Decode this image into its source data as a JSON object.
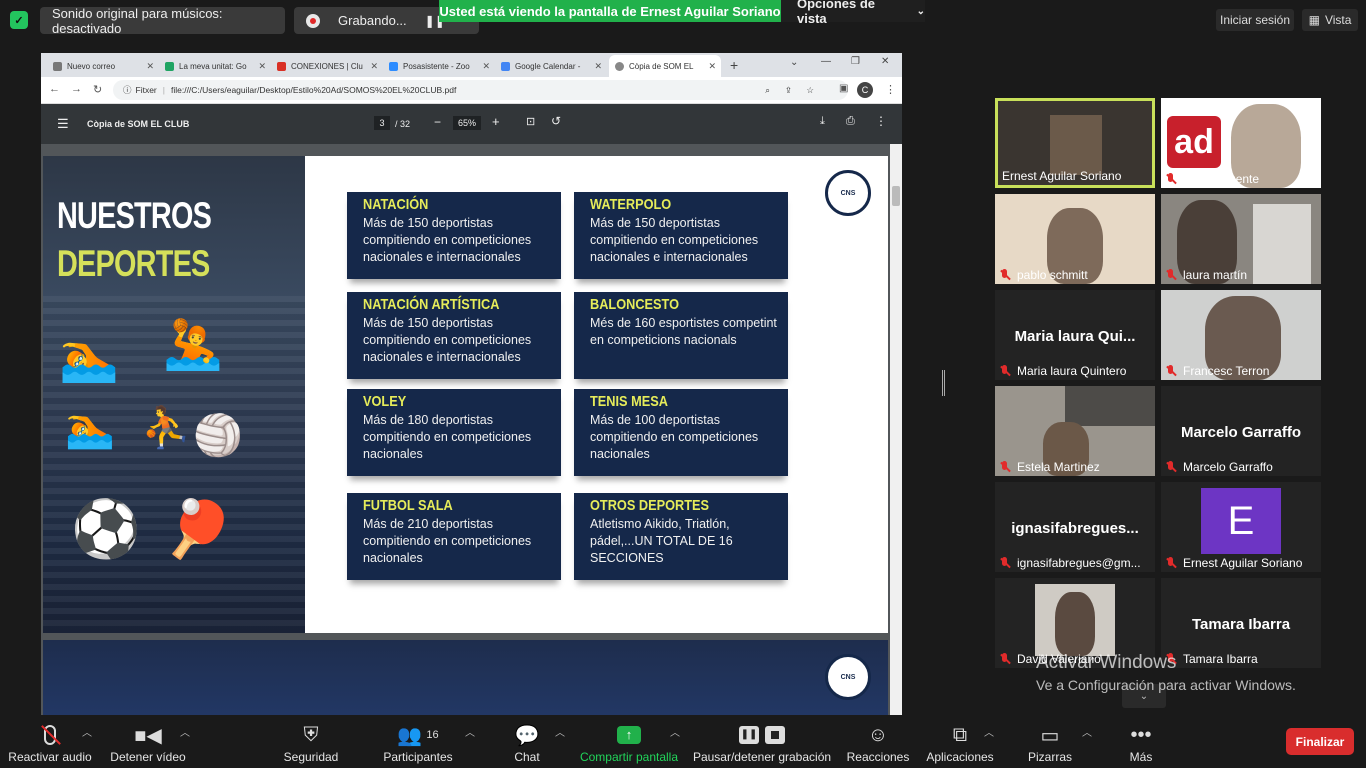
{
  "topbar": {
    "original_sound": "Sonido original para músicos: desactivado",
    "recording": "Grabando...",
    "share_banner": "Usted está viendo la pantalla de Ernest Aguilar Soriano",
    "view_options": "Opciones de vista",
    "sign_in": "Iniciar sesión",
    "view": "Vista"
  },
  "browser": {
    "tabs": [
      "Nuevo correo",
      "La meva unitat: Go",
      "CONEXIONES | Clu",
      "Posasistente - Zoo",
      "Google Calendar -",
      "Còpia de SOM EL"
    ],
    "url_label": "Fitxer",
    "url": "file:///C:/Users/eaguilar/Desktop/Estilo%20Ad/SOMOS%20EL%20CLUB.pdf",
    "profile_initial": "C"
  },
  "pdf": {
    "title": "Còpia de SOM EL CLUB",
    "page_current": "3",
    "page_total": "/ 32",
    "zoom": "65%"
  },
  "slide": {
    "heading_1": "NUESTROS",
    "heading_2": "DEPORTES",
    "cards": [
      {
        "title": "NATACIÓN",
        "text": "Más de 150 deportistas compitiendo en competiciones nacionales e internacionales"
      },
      {
        "title": "WATERPOLO",
        "text": "Más de 150 deportistas compitiendo en competiciones nacionales e internacionales"
      },
      {
        "title": "NATACIÓN ARTÍSTICA",
        "text": "Más de 150 deportistas compitiendo en competiciones nacionales e internacionales"
      },
      {
        "title": "BALONCESTO",
        "text": "Més de 160 esportistes competint en competicions nacionals"
      },
      {
        "title": "VOLEY",
        "text": "Más de 180 deportistas compitiendo en competiciones nacionales"
      },
      {
        "title": "TENIS MESA",
        "text": "Más de 100 deportistas compitiendo en competiciones nacionales"
      },
      {
        "title": "FUTBOL SALA",
        "text": "Más de 210 deportistas compitiendo en competiciones nacionales"
      },
      {
        "title": "OTROS DEPORTES",
        "text": "Atletismo Aikido, Triatlón, pádel,...UN TOTAL DE 16 SECCIONES"
      }
    ]
  },
  "participants": [
    {
      "name": "Ernest Aguilar Soriano",
      "big": "",
      "muted": false,
      "active": true,
      "bg": "#3a3530"
    },
    {
      "name": "Sergio Puente",
      "big": "",
      "muted": true,
      "active": false,
      "bg": "#ffffff"
    },
    {
      "name": "pablo schmitt",
      "big": "",
      "muted": true,
      "active": false,
      "bg": "#e7d9c6"
    },
    {
      "name": "laura martín",
      "big": "",
      "muted": true,
      "active": false,
      "bg": "#8a8680"
    },
    {
      "name": "Maria laura Quintero",
      "big": "Maria laura Qui...",
      "muted": true,
      "active": false,
      "bg": "#232323"
    },
    {
      "name": "Francesc Terron",
      "big": "",
      "muted": true,
      "active": false,
      "bg": "#cfd0cf"
    },
    {
      "name": "Estela Martinez",
      "big": "",
      "muted": true,
      "active": false,
      "bg": "#9a958d"
    },
    {
      "name": "Marcelo Garraffo",
      "big": "Marcelo Garraffo",
      "muted": true,
      "active": false,
      "bg": "#232323"
    },
    {
      "name": "ignasifabregues@gm...",
      "big": "ignasifabregues...",
      "muted": true,
      "active": false,
      "bg": "#232323"
    },
    {
      "name": "Ernest Aguilar Soriano",
      "big": "",
      "muted": true,
      "active": false,
      "bg": "#232323"
    },
    {
      "name": "David Valeriano",
      "big": "",
      "muted": true,
      "active": false,
      "bg": "#232323"
    },
    {
      "name": "Tamara Ibarra",
      "big": "Tamara Ibarra",
      "muted": true,
      "active": false,
      "bg": "#232323"
    }
  ],
  "avatar_letter": "E",
  "ad_logo": "ad",
  "watermark": {
    "line1": "Activar Windows",
    "line2": "Ve a Configuración para activar Windows."
  },
  "toolbar": {
    "audio": "Reactivar audio",
    "video": "Detener vídeo",
    "security": "Seguridad",
    "participants": "Participantes",
    "participants_count": "16",
    "chat": "Chat",
    "share": "Compartir pantalla",
    "pause_record": "Pausar/detener grabación",
    "reactions": "Reacciones",
    "apps": "Aplicaciones",
    "whiteboards": "Pizarras",
    "more": "Más",
    "end": "Finalizar"
  },
  "colors": {
    "share_green": "#21b14b",
    "active_border": "#c8e05a",
    "end_red": "#d92d2d",
    "card_navy": "#15284a",
    "title_yellow": "#e6ec5a"
  }
}
